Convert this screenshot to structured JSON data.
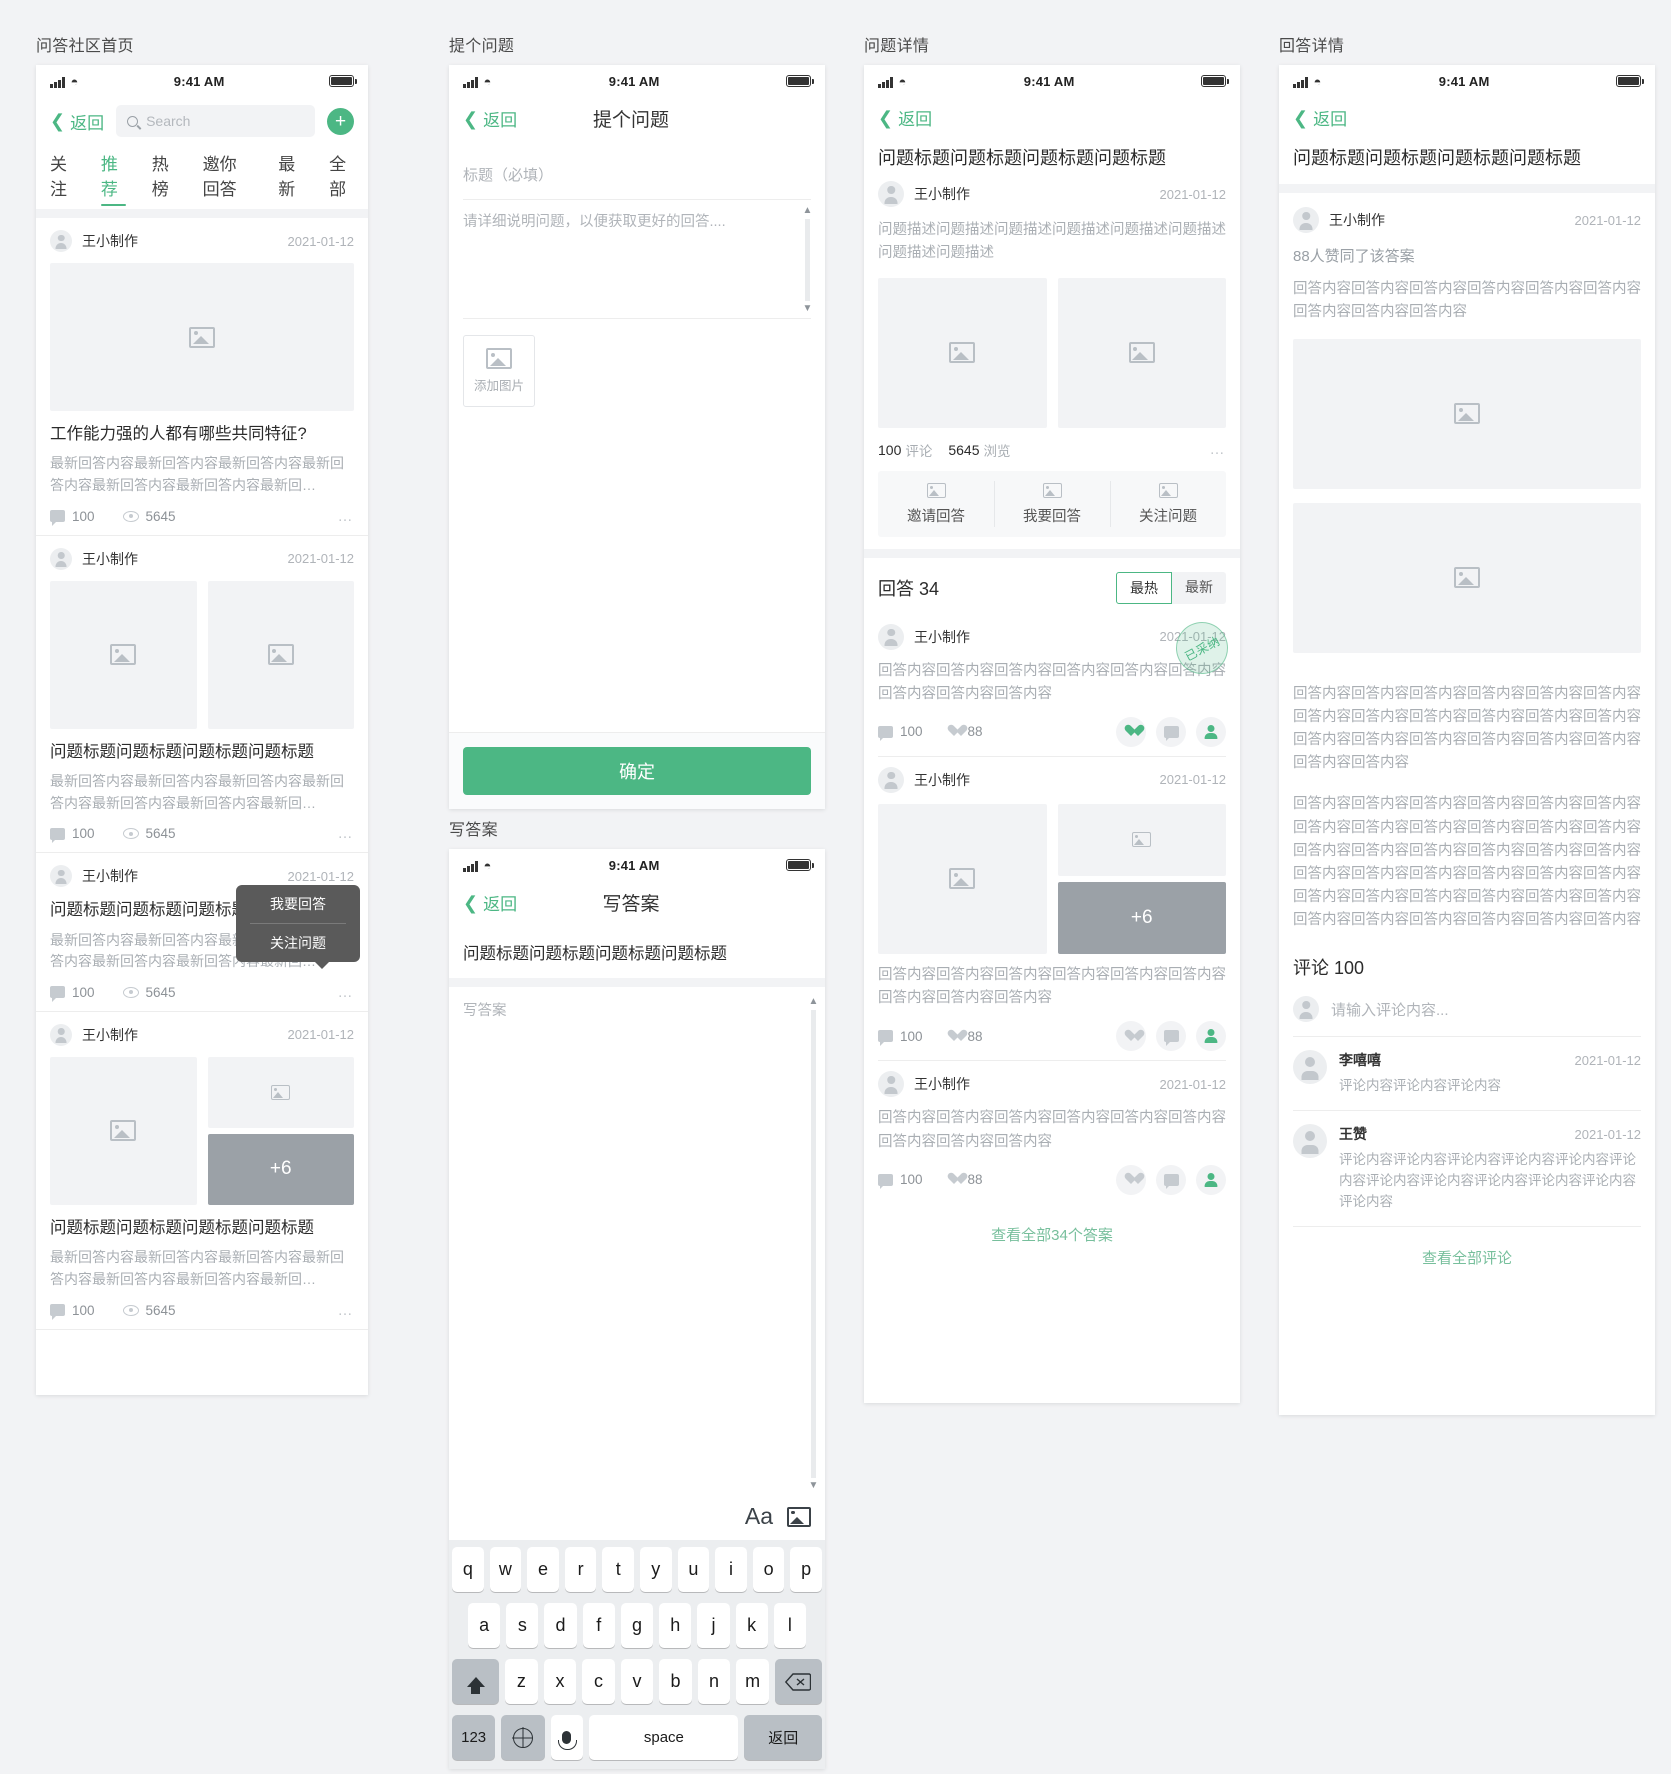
{
  "common": {
    "status_time": "9:41 AM",
    "back_label": "返回",
    "user_name": "王小制作",
    "date": "2021-01-12",
    "comment_count": "100",
    "view_count": "5645",
    "like_count": "88",
    "accent_color": "#4cb784"
  },
  "panel1": {
    "label": "问答社区首页",
    "search_placeholder": "Search",
    "add_button": "+",
    "tabs": [
      {
        "label": "关注",
        "active": false
      },
      {
        "label": "推荐",
        "active": true
      },
      {
        "label": "热榜",
        "active": false
      },
      {
        "label": "邀你回答",
        "active": false
      },
      {
        "label": "最新",
        "active": false
      },
      {
        "label": "全部",
        "active": false
      }
    ],
    "feed": [
      {
        "user": "王小制作",
        "date": "2021-01-12",
        "media": "single",
        "title": "工作能力强的人都有哪些共同特征?",
        "excerpt": "最新回答内容最新回答内容最新回答内容最新回答内容最新回答内容最新回答内容最新回…",
        "comments": "100",
        "views": "5645"
      },
      {
        "user": "王小制作",
        "date": "2021-01-12",
        "media": "double",
        "title": "问题标题问题标题问题标题问题标题",
        "excerpt": "最新回答内容最新回答内容最新回答内容最新回答内容最新回答内容最新回答内容最新回…",
        "comments": "100",
        "views": "5645"
      },
      {
        "user": "王小制作",
        "date": "2021-01-12",
        "media": "none",
        "title": "问题标题问题标题问题标题问题标题",
        "excerpt": "最新回答内容最新回答内容最新回答内容最新回答内容最新回答内容最新回答内容最新回…",
        "comments": "100",
        "views": "5645"
      },
      {
        "user": "王小制作",
        "date": "2021-01-12",
        "media": "plus",
        "overflow_label": "+6",
        "title": "问题标题问题标题问题标题问题标题",
        "excerpt": "最新回答内容最新回答内容最新回答内容最新回答内容最新回答内容最新回答内容最新回…",
        "comments": "100",
        "views": "5645"
      }
    ],
    "tooltip": {
      "item1": "我要回答",
      "item2": "关注问题"
    }
  },
  "panel2": {
    "label": "提个问题",
    "nav_title": "提个问题",
    "title_placeholder": "标题（必填）",
    "detail_placeholder": "请详细说明问题，以便获取更好的回答....",
    "add_image_label": "添加图片",
    "submit_label": "确定"
  },
  "panel3": {
    "label": "写答案",
    "nav_title": "写答案",
    "question_title": "问题标题问题标题问题标题问题标题",
    "editor_placeholder": "写答案",
    "toolbar": {
      "font_label": "Aa",
      "image_label": "image-icon"
    },
    "keyboard": {
      "row1": [
        "q",
        "w",
        "e",
        "r",
        "t",
        "y",
        "u",
        "i",
        "o",
        "p"
      ],
      "row2": [
        "a",
        "s",
        "d",
        "f",
        "g",
        "h",
        "j",
        "k",
        "l"
      ],
      "row3": [
        "z",
        "x",
        "c",
        "v",
        "b",
        "n",
        "m"
      ],
      "num_key": "123",
      "space_key": "space",
      "return_key": "返回"
    }
  },
  "panel4": {
    "label": "问题详情",
    "title": "问题标题问题标题问题标题问题标题",
    "user": "王小制作",
    "date": "2021-01-12",
    "description": "问题描述问题描述问题描述问题描述问题描述问题描述问题描述问题描述",
    "stats": {
      "comments": "100",
      "comments_label": "评论",
      "views": "5645",
      "views_label": "浏览"
    },
    "actions": [
      {
        "label": "邀请回答"
      },
      {
        "label": "我要回答"
      },
      {
        "label": "关注问题"
      }
    ],
    "answers_heading": "回答 34",
    "sort": [
      {
        "label": "最热",
        "active": true
      },
      {
        "label": "最新",
        "active": false
      }
    ],
    "answers": [
      {
        "user": "王小制作",
        "date": "2021-01-12",
        "badge": "已采纳",
        "media": "none",
        "text": "回答内容回答内容回答内容回答内容回答内容回答内容回答内容回答内容回答内容",
        "comments": "100",
        "likes": "88",
        "liked": true
      },
      {
        "user": "王小制作",
        "date": "2021-01-12",
        "media": "plus",
        "overflow_label": "+6",
        "text": "回答内容回答内容回答内容回答内容回答内容回答内容回答内容回答内容回答内容",
        "comments": "100",
        "likes": "88",
        "liked": false
      },
      {
        "user": "王小制作",
        "date": "2021-01-12",
        "media": "none",
        "text": "回答内容回答内容回答内容回答内容回答内容回答内容回答内容回答内容回答内容",
        "comments": "100",
        "likes": "88",
        "liked": false
      }
    ],
    "view_all": "查看全部34个答案"
  },
  "panel5": {
    "label": "回答详情",
    "title": "问题标题问题标题问题标题问题标题",
    "user": "王小制作",
    "date": "2021-01-12",
    "upvote_text": "88人赞同了该答案",
    "intro_text": "回答内容回答内容回答内容回答内容回答内容回答内容回答内容回答内容回答内容",
    "body_text_1": "回答内容回答内容回答内容回答内容回答内容回答内容回答内容回答内容回答内容回答内容回答内容回答内容回答内容回答内容回答内容回答内容回答内容回答内容回答内容回答内容",
    "body_text_2": "回答内容回答内容回答内容回答内容回答内容回答内容回答内容回答内容回答内容回答内容回答内容回答内容回答内容回答内容回答内容回答内容回答内容回答内容回答内容回答内容回答内容回答内容回答内容回答内容回答内容回答内容回答内容回答内容回答内容回答内容回答内容回答内容回答内容回答内容回答内容回答内容",
    "comments_heading": "评论 100",
    "comment_placeholder": "请输入评论内容...",
    "comments": [
      {
        "name": "李嘻嘻",
        "date": "2021-01-12",
        "text": "评论内容评论内容评论内容"
      },
      {
        "name": "王赞",
        "date": "2021-01-12",
        "text": "评论内容评论内容评论内容评论内容评论内容评论内容评论内容评论内容评论内容评论内容评论内容评论内容"
      }
    ],
    "view_all": "查看全部评论"
  }
}
